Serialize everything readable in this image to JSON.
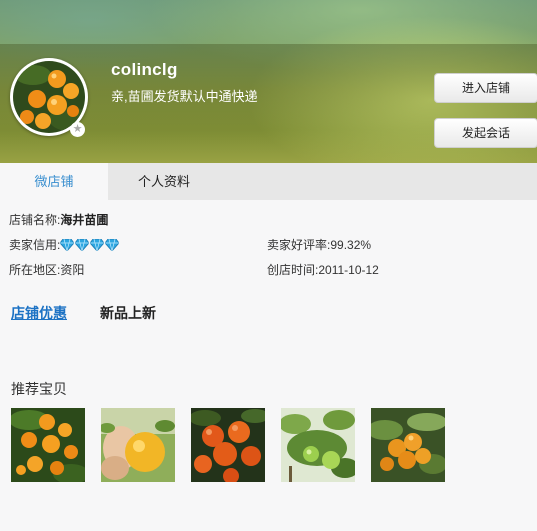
{
  "header": {
    "shop_id": "colinclg",
    "notice": "亲,苗圃发货默认中通快递",
    "enter_shop_label": "进入店铺",
    "chat_label": "发起会话",
    "avatar_badge_icon": "star-icon"
  },
  "tabs": [
    {
      "label": "微店铺",
      "active": true
    },
    {
      "label": "个人资料",
      "active": false
    }
  ],
  "info": {
    "shop_name_label": "店铺名称:",
    "shop_name_value": "海井苗圃",
    "credit_label": "卖家信用:",
    "credit_diamonds": 4,
    "rating_label": "卖家好评率:",
    "rating_value": "99.32%",
    "region_label": "所在地区:",
    "region_value": "资阳",
    "opened_label": "创店时间:",
    "opened_value": "2011-10-12"
  },
  "sections": {
    "promo_label": "店铺优惠",
    "new_label": "新品上新"
  },
  "recommend": {
    "title": "推荐宝贝",
    "items": [
      "orange-tree",
      "orange-in-hand",
      "tangerines-cluster",
      "green-citrus",
      "loquats"
    ]
  },
  "colors": {
    "tab_active": "#3a8fcf",
    "link": "#1c72c4",
    "diamond": "#2ea6e0"
  }
}
